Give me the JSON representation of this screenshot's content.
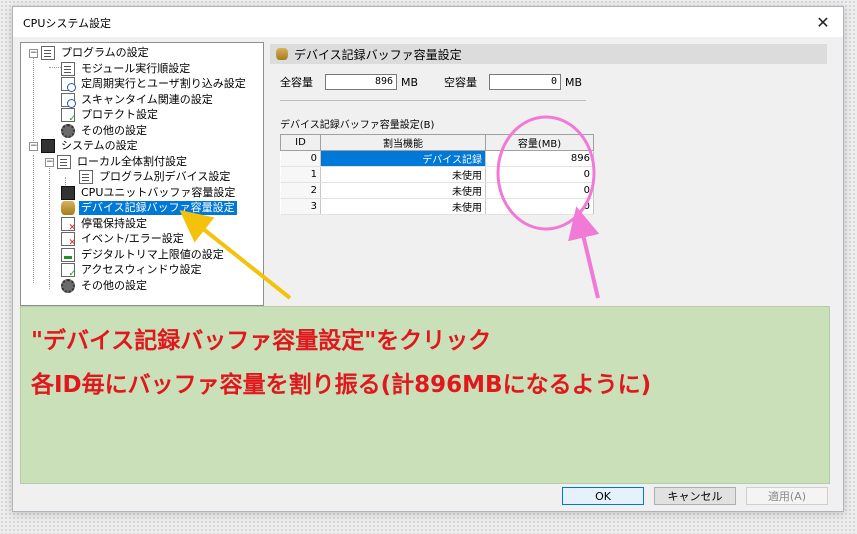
{
  "window": {
    "title": "CPUシステム設定",
    "close_glyph": "✕"
  },
  "tree": {
    "nodes": [
      {
        "label": "プログラムの設定",
        "expander": "−"
      },
      {
        "label": "モジュール実行順設定"
      },
      {
        "label": "定周期実行とユーザ割り込み設定"
      },
      {
        "label": "スキャンタイム関連の設定"
      },
      {
        "label": "プロテクト設定"
      },
      {
        "label": "その他の設定"
      },
      {
        "label": "システムの設定",
        "expander": "−"
      },
      {
        "label": "ローカル全体割付設定",
        "expander": "−"
      },
      {
        "label": "プログラム別デバイス設定"
      },
      {
        "label": "CPUユニットバッファ容量設定"
      },
      {
        "label": "デバイス記録バッファ容量設定",
        "selected": true
      },
      {
        "label": "停電保持設定"
      },
      {
        "label": "イベント/エラー設定"
      },
      {
        "label": "デジタルトリマ上限値の設定"
      },
      {
        "label": "アクセスウィンドウ設定"
      },
      {
        "label": "その他の設定"
      }
    ]
  },
  "panel": {
    "header": "デバイス記録バッファ容量設定",
    "total_label": "全容量",
    "total_value": "896",
    "free_label": "空容量",
    "free_value": "0",
    "unit": "MB",
    "table_caption": "デバイス記録バッファ容量設定(B)",
    "columns": [
      "ID",
      "割当機能",
      "容量(MB)"
    ],
    "rows": [
      {
        "id": "0",
        "function": "デバイス記録",
        "capacity": "896"
      },
      {
        "id": "1",
        "function": "未使用",
        "capacity": "0"
      },
      {
        "id": "2",
        "function": "未使用",
        "capacity": "0"
      },
      {
        "id": "3",
        "function": "未使用",
        "capacity": "0"
      }
    ]
  },
  "annotation": {
    "line1": "\"デバイス記録バッファ容量設定\"をクリック",
    "line2": "各ID毎にバッファ容量を割り振る(計896MBになるように)"
  },
  "buttons": {
    "ok": "OK",
    "cancel": "キャンセル",
    "apply": "適用(A)"
  },
  "colors": {
    "selection": "#0078d7",
    "annotation_bg": "#c9e0b9",
    "annotation_text": "#e0171c",
    "yellow_arrow": "#f4c20d",
    "pink_highlight": "#f07ad6"
  }
}
